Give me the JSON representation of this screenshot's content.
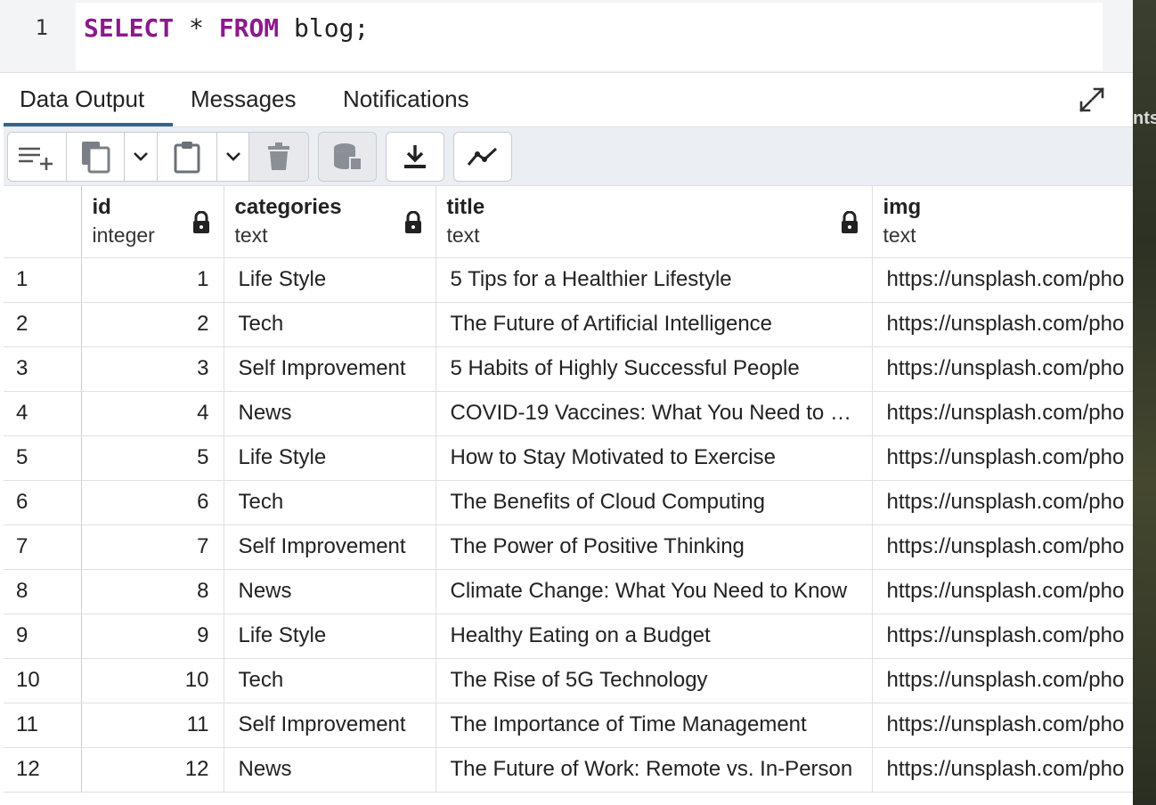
{
  "editor": {
    "line_number": "1",
    "kw_select": "SELECT",
    "star": "*",
    "kw_from": "FROM",
    "rest": "blog;"
  },
  "tabs": [
    {
      "label": "Data Output",
      "active": true
    },
    {
      "label": "Messages",
      "active": false
    },
    {
      "label": "Notifications",
      "active": false
    }
  ],
  "toolbar": {
    "icons": [
      "add-row-icon",
      "copy-icon",
      "chevron-down-icon",
      "paste-icon",
      "chevron-down-icon",
      "delete-icon",
      "save-data-icon",
      "download-icon",
      "graph-icon"
    ]
  },
  "grid": {
    "columns": [
      {
        "name": "id",
        "type": "integer",
        "locked": true
      },
      {
        "name": "categories",
        "type": "text",
        "locked": true
      },
      {
        "name": "title",
        "type": "text",
        "locked": true
      },
      {
        "name": "img",
        "type": "text",
        "locked": false
      }
    ],
    "rows": [
      {
        "n": "1",
        "id": "1",
        "categories": "Life Style",
        "title": "5 Tips for a Healthier Lifestyle",
        "img": "https://unsplash.com/pho"
      },
      {
        "n": "2",
        "id": "2",
        "categories": "Tech",
        "title": "The Future of Artificial Intelligence",
        "img": "https://unsplash.com/pho"
      },
      {
        "n": "3",
        "id": "3",
        "categories": "Self Improvement",
        "title": "5 Habits of Highly Successful People",
        "img": "https://unsplash.com/pho"
      },
      {
        "n": "4",
        "id": "4",
        "categories": "News",
        "title": "COVID-19 Vaccines: What You Need to …",
        "img": "https://unsplash.com/pho"
      },
      {
        "n": "5",
        "id": "5",
        "categories": "Life Style",
        "title": "How to Stay Motivated to Exercise",
        "img": "https://unsplash.com/pho"
      },
      {
        "n": "6",
        "id": "6",
        "categories": "Tech",
        "title": "The Benefits of Cloud Computing",
        "img": "https://unsplash.com/pho"
      },
      {
        "n": "7",
        "id": "7",
        "categories": "Self Improvement",
        "title": "The Power of Positive Thinking",
        "img": "https://unsplash.com/pho"
      },
      {
        "n": "8",
        "id": "8",
        "categories": "News",
        "title": "Climate Change: What You Need to Know",
        "img": "https://unsplash.com/pho"
      },
      {
        "n": "9",
        "id": "9",
        "categories": "Life Style",
        "title": "Healthy Eating on a Budget",
        "img": "https://unsplash.com/pho"
      },
      {
        "n": "10",
        "id": "10",
        "categories": "Tech",
        "title": "The Rise of 5G Technology",
        "img": "https://unsplash.com/pho"
      },
      {
        "n": "11",
        "id": "11",
        "categories": "Self Improvement",
        "title": "The Importance of Time Management",
        "img": "https://unsplash.com/pho"
      },
      {
        "n": "12",
        "id": "12",
        "categories": "News",
        "title": "The Future of Work: Remote vs. In-Person",
        "img": "https://unsplash.com/pho"
      }
    ]
  },
  "edge_text": "nts",
  "colors": {
    "keyword": "#8b1a8b",
    "active_tab_underline": "#326690",
    "toolbar_bg": "#ebeef3",
    "border": "#dde0e6"
  }
}
